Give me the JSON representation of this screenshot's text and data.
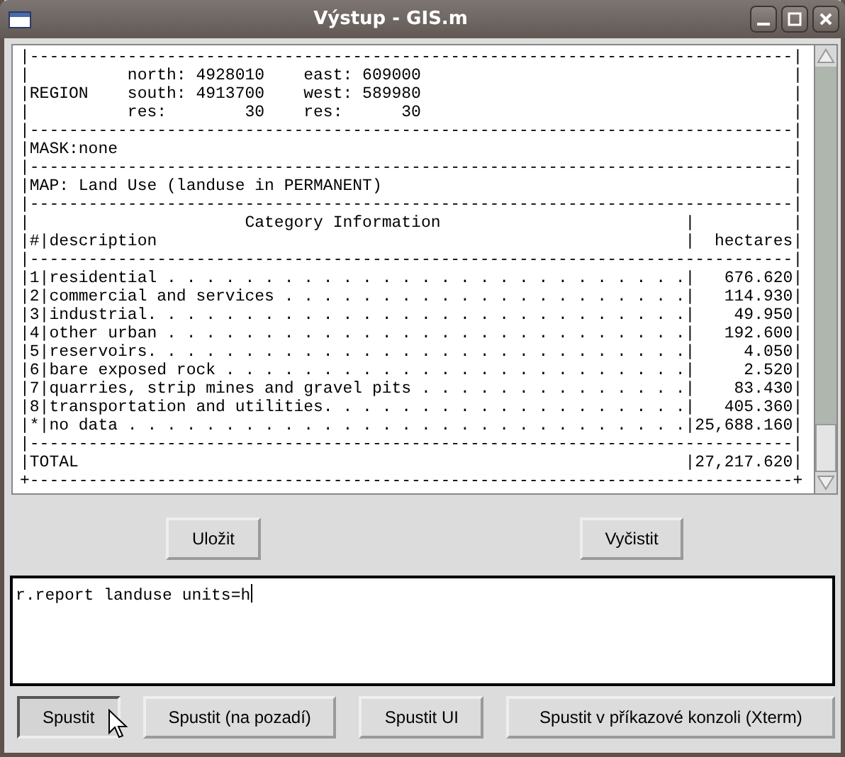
{
  "window": {
    "title": "Výstup - GIS.m"
  },
  "output_lines": [
    "|------------------------------------------------------------------------------|",
    "|          north: 4928010    east: 609000                                      |",
    "|REGION    south: 4913700    west: 589980                                      |",
    "|          res:        30    res:      30                                      |",
    "|------------------------------------------------------------------------------|",
    "|MASK:none                                                                     |",
    "|------------------------------------------------------------------------------|",
    "|MAP: Land Use (landuse in PERMANENT)                                          |",
    "|------------------------------------------------------------------------------|",
    "|                      Category Information                         |          |",
    "|#|description                                                      |  hectares|",
    "|------------------------------------------------------------------------------|",
    "|1|residential . . . . . . . . . . . . . . . . . . . . . . . . . . .|   676.620|",
    "|2|commercial and services . . . . . . . . . . . . . . . . . . . . .|   114.930|",
    "|3|industrial. . . . . . . . . . . . . . . . . . . . . . . . . . . .|    49.950|",
    "|4|other urban . . . . . . . . . . . . . . . . . . . . . . . . . . .|   192.600|",
    "|5|reservoirs. . . . . . . . . . . . . . . . . . . . . . . . . . . .|     4.050|",
    "|6|bare exposed rock . . . . . . . . . . . . . . . . . . . . . . . .|     2.520|",
    "|7|quarries, strip mines and gravel pits . . . . . . . . . . . . . .|    83.430|",
    "|8|transportation and utilities. . . . . . . . . . . . . . . . . . .|   405.360|",
    "|*|no data . . . . . . . . . . . . . . . . . . . . . . . . . . . . .|25,688.160|",
    "|------------------------------------------------------------------------------|",
    "|TOTAL                                                              |27,217.620|",
    "+------------------------------------------------------------------------------+"
  ],
  "output_buttons": [
    {
      "label": "Uložit",
      "focused": false
    },
    {
      "label": "Vyčistit",
      "focused": false
    }
  ],
  "command": {
    "value": "r.report landuse units=h"
  },
  "run_buttons": [
    {
      "label": "Spustit",
      "focused": true
    },
    {
      "label": "Spustit (na pozadí)",
      "focused": false
    },
    {
      "label": "Spustit UI",
      "focused": false
    },
    {
      "label": "Spustit v příkazové konzoli (Xterm)",
      "focused": false
    }
  ]
}
